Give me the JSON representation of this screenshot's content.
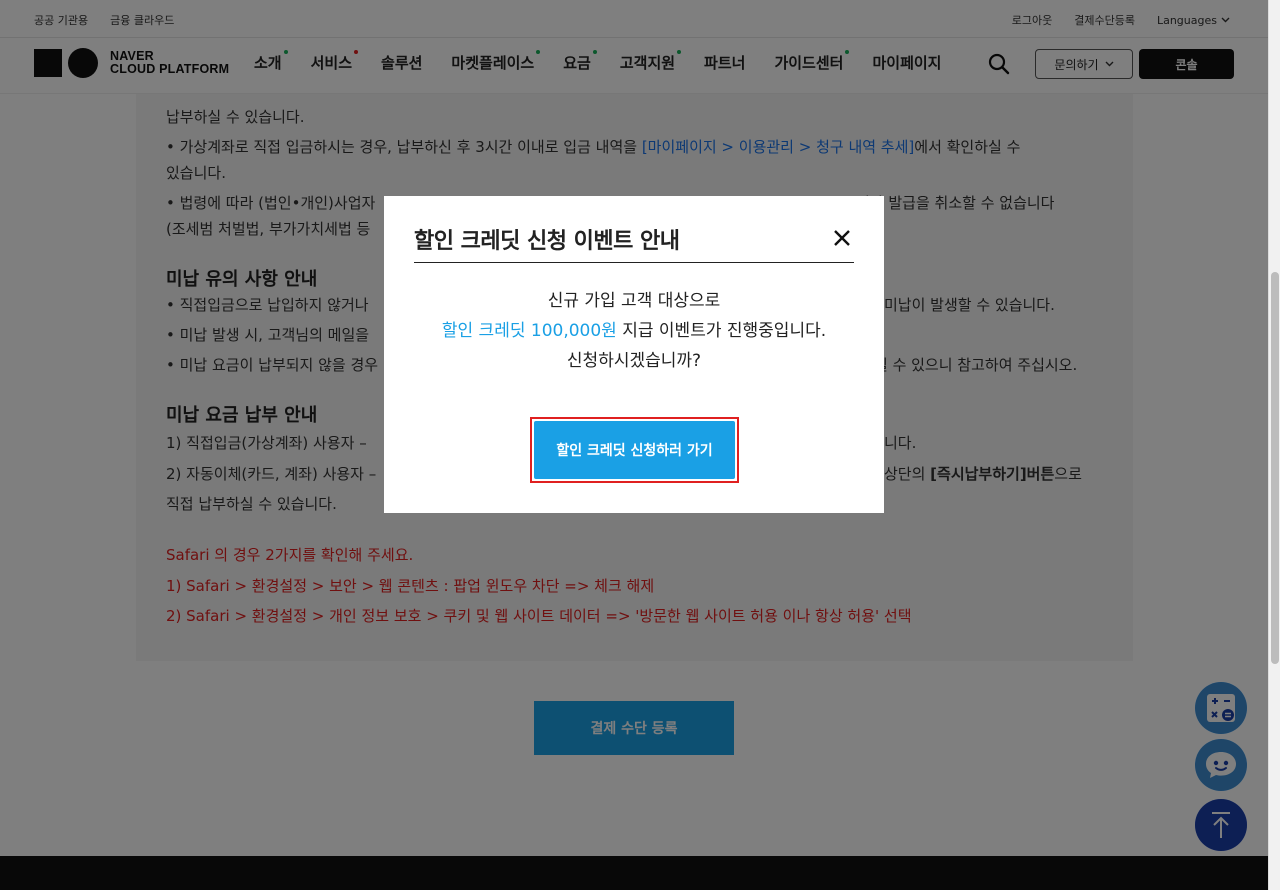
{
  "util_bar": {
    "left_links": [
      "공공 기관용",
      "금융 클라우드"
    ],
    "right_links": [
      "로그아웃",
      "결제수단등록"
    ],
    "language_label": "Languages"
  },
  "header": {
    "logo_line1": "NAVER",
    "logo_line2": "CLOUD PLATFORM",
    "nav_items": [
      {
        "label": "소개",
        "dot": "#19b05a"
      },
      {
        "label": "서비스",
        "dot": "#e02020"
      },
      {
        "label": "솔루션",
        "dot": ""
      },
      {
        "label": "마켓플레이스",
        "dot": "#19b05a"
      },
      {
        "label": "요금",
        "dot": "#19b05a"
      },
      {
        "label": "고객지원",
        "dot": "#19b05a"
      },
      {
        "label": "파트너",
        "dot": ""
      },
      {
        "label": "가이드센터",
        "dot": "#19b05a"
      },
      {
        "label": "마이페이지",
        "dot": ""
      }
    ],
    "inquiry_label": "문의하기",
    "console_label": "콘솔"
  },
  "content": {
    "line1": "납부하실 수 있습니다.",
    "line2_prefix": "• 가상계좌로 직접 입금하시는 경우, 납부하신 후 3시간 이내로 입금 내역을 ",
    "line2_link": "[마이페이지 > 이용관리 > 청구 내역 추세]",
    "line2_suffix": "에서 확인하실 수",
    "line3": "있습니다.",
    "line4_a": "• 법령에 따라 (법인•개인)사업자",
    "line4_b": "거나 발급을 취소할 수 없습니다",
    "line5": "(조세범 처벌법, 부가가치세법 등",
    "section1_title": "미납 유의 사항 안내",
    "s1_l1_a": "• 직접입금으로 납입하지 않거나",
    "s1_l1_b": "미납이 발생할 수 있습니다.",
    "s1_l2_a": "• 미납 발생 시, 고객님의 메일을",
    "s1_l3_a": "• 미납 요금이 납부되지 않을 경우",
    "s1_l3_b": "될 수 있으니 참고하여 주십시오.",
    "section2_title": "미납 요금 납부 안내",
    "s2_l1_a": "1) 직접입금(가상계좌) 사용자 –",
    "s2_l1_b": "니다.",
    "s2_l2_a": "2) 자동이체(카드, 계좌) 사용자 –",
    "s2_l2_b": "상단의 ",
    "s2_l2_bold": "[즉시납부하기]버튼",
    "s2_l2_c": "으로",
    "s2_l3": "직접 납부하실 수 있습니다.",
    "safari_1": "Safari 의 경우 2가지를 확인해 주세요.",
    "safari_2": "1) Safari > 환경설정 > 보안 > 웹 콘텐츠 : 팝업 윈도우 차단 => 체크 해제",
    "safari_3": "2) Safari > 환경설정 > 개인 정보 보호 > 쿠키 및 웹 사이트 데이터 => '방문한 웹 사이트 허용 이나 항상 허용' 선택",
    "pay_button": "결제 수단 등록"
  },
  "modal": {
    "title": "할인 크레딧 신청 이벤트 안내",
    "line1": "신규 가입 고객 대상으로",
    "line2_highlight": "할인 크레딧 100,000원",
    "line2_rest": " 지급 이벤트가 진행중입니다.",
    "line3": "신청하시겠습니까?",
    "cta": "할인 크레딧 신청하러 가기"
  },
  "floating": {
    "calc": "calculator-icon",
    "chat": "chatbot-icon",
    "top": "arrow-up-icon"
  },
  "colors": {
    "accent": "#1aa0e5",
    "highlight_outline": "#e02020",
    "link": "#1a73e8",
    "warning_text": "#e02020"
  }
}
